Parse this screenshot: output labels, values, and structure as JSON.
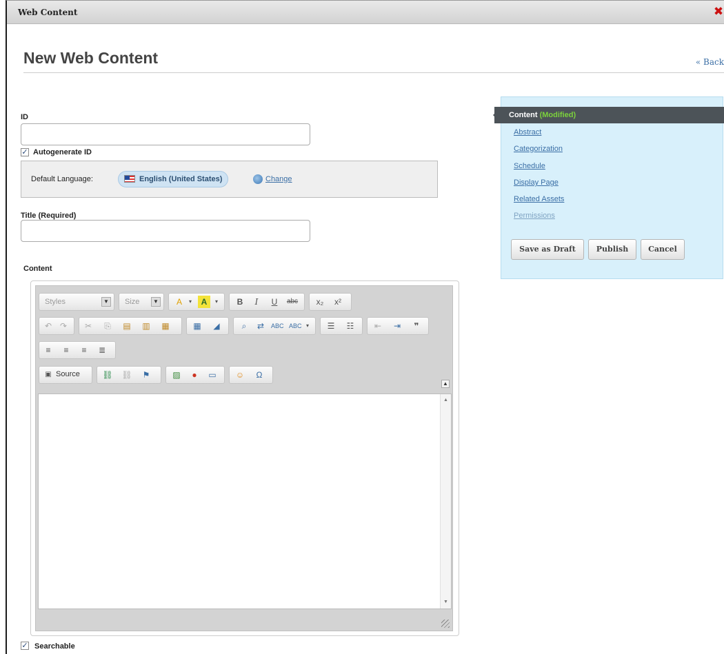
{
  "window": {
    "title": "Web Content",
    "close_icon": "close-icon",
    "close_color": "#cc1111"
  },
  "header": {
    "page_title": "New Web Content",
    "back_link": "« Back"
  },
  "form": {
    "id_label": "ID",
    "id_value": "",
    "autogenerate_label": "Autogenerate ID",
    "autogenerate_checked": true,
    "default_language_label": "Default Language:",
    "language_value": "English (United States)",
    "change_link": "Change",
    "title_label": "Title (Required)",
    "title_value": "",
    "content_label": "Content",
    "searchable_label": "Searchable",
    "searchable_checked": true
  },
  "editor": {
    "styles_placeholder": "Styles",
    "size_placeholder": "Size",
    "source_label": "Source",
    "body_text": ""
  },
  "sidebar": {
    "active_item": "Content",
    "active_item_status": "(Modified)",
    "items": [
      {
        "label": "Abstract"
      },
      {
        "label": "Categorization"
      },
      {
        "label": "Schedule"
      },
      {
        "label": "Display Page"
      },
      {
        "label": "Related Assets"
      },
      {
        "label": "Permissions"
      }
    ],
    "buttons": {
      "save_draft": "Save as Draft",
      "publish": "Publish",
      "cancel": "Cancel"
    },
    "accent_color": "#4c5358",
    "panel_color": "#d8f0fb",
    "modified_color": "#7cd23c"
  }
}
